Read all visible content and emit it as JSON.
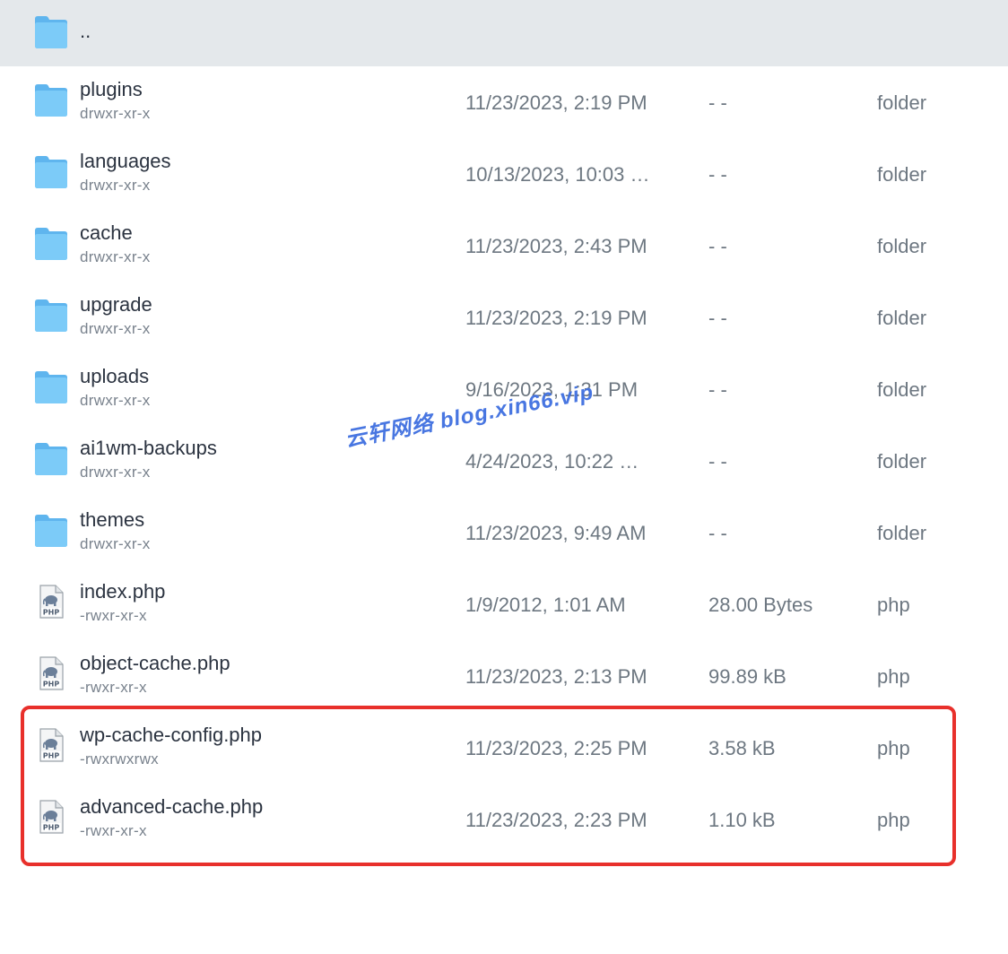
{
  "parent_row": {
    "name": "..",
    "icon": "folder-icon"
  },
  "rows": [
    {
      "name": "plugins",
      "permissions": "drwxr-xr-x",
      "modified": "11/23/2023, 2:19 PM",
      "size": "- -",
      "type": "folder",
      "icon": "folder-icon"
    },
    {
      "name": "languages",
      "permissions": "drwxr-xr-x",
      "modified": "10/13/2023, 10:03 …",
      "size": "- -",
      "type": "folder",
      "icon": "folder-icon"
    },
    {
      "name": "cache",
      "permissions": "drwxr-xr-x",
      "modified": "11/23/2023, 2:43 PM",
      "size": "- -",
      "type": "folder",
      "icon": "folder-icon"
    },
    {
      "name": "upgrade",
      "permissions": "drwxr-xr-x",
      "modified": "11/23/2023, 2:19 PM",
      "size": "- -",
      "type": "folder",
      "icon": "folder-icon"
    },
    {
      "name": "uploads",
      "permissions": "drwxr-xr-x",
      "modified": "9/16/2023, 1:31 PM",
      "size": "- -",
      "type": "folder",
      "icon": "folder-icon"
    },
    {
      "name": "ai1wm-backups",
      "permissions": "drwxr-xr-x",
      "modified": "4/24/2023, 10:22 …",
      "size": "- -",
      "type": "folder",
      "icon": "folder-icon"
    },
    {
      "name": "themes",
      "permissions": "drwxr-xr-x",
      "modified": "11/23/2023, 9:49 AM",
      "size": "- -",
      "type": "folder",
      "icon": "folder-icon"
    },
    {
      "name": "index.php",
      "permissions": "-rwxr-xr-x",
      "modified": "1/9/2012, 1:01 AM",
      "size": "28.00 Bytes",
      "type": "php",
      "icon": "php-file-icon"
    },
    {
      "name": "object-cache.php",
      "permissions": "-rwxr-xr-x",
      "modified": "11/23/2023, 2:13 PM",
      "size": "99.89 kB",
      "type": "php",
      "icon": "php-file-icon"
    },
    {
      "name": "wp-cache-config.php",
      "permissions": "-rwxrwxrwx",
      "modified": "11/23/2023, 2:25 PM",
      "size": "3.58 kB",
      "type": "php",
      "icon": "php-file-icon"
    },
    {
      "name": "advanced-cache.php",
      "permissions": "-rwxr-xr-x",
      "modified": "11/23/2023, 2:23 PM",
      "size": "1.10 kB",
      "type": "php",
      "icon": "php-file-icon"
    }
  ],
  "watermark": "云轩网络 blog.xin66.vip",
  "colors": {
    "folder": "#6cc0f5",
    "highlight_border": "#e8302b",
    "watermark": "#3f6fe0",
    "parent_row_bg": "#e4e8eb"
  }
}
